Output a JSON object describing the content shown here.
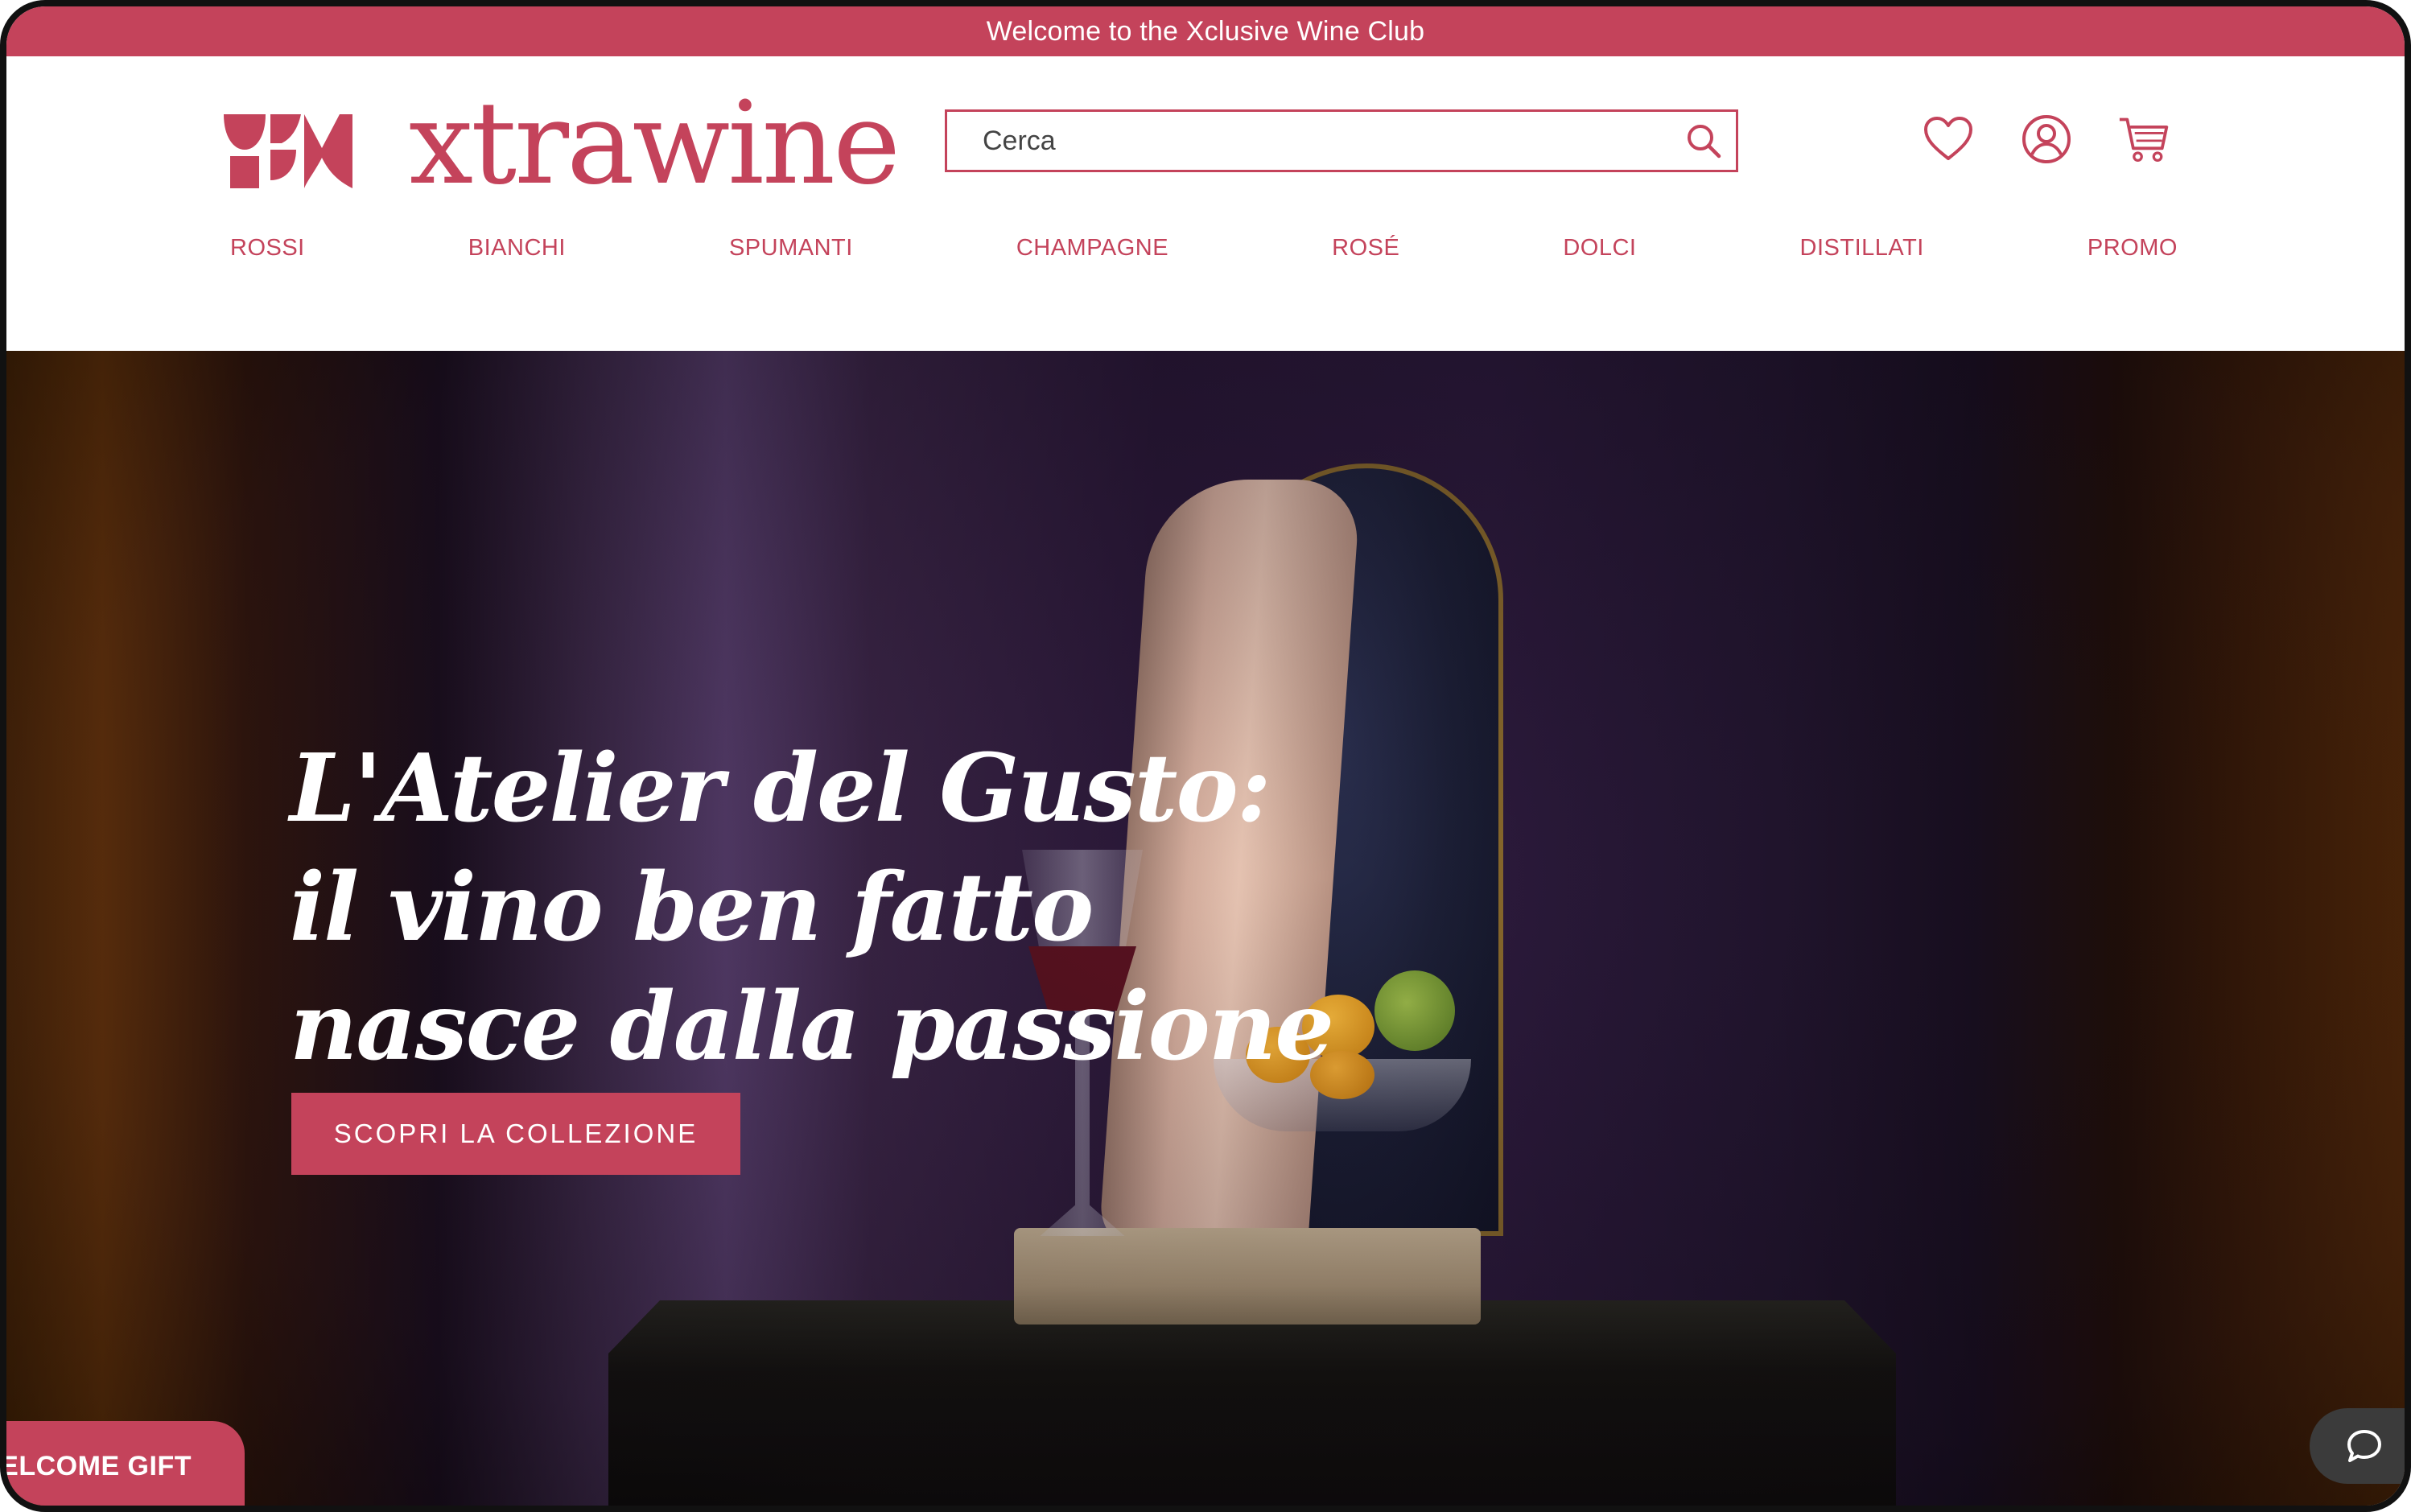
{
  "promo_bar": {
    "text": "Welcome to the Xclusive Wine Club"
  },
  "header": {
    "logo_text": "xtrawine",
    "search": {
      "placeholder": "Cerca"
    },
    "icons": [
      "heart-icon",
      "account-icon",
      "cart-icon"
    ]
  },
  "nav": {
    "items": [
      {
        "label": "ROSSI"
      },
      {
        "label": "BIANCHI"
      },
      {
        "label": "SPUMANTI"
      },
      {
        "label": "CHAMPAGNE"
      },
      {
        "label": "ROSÉ"
      },
      {
        "label": "DOLCI"
      },
      {
        "label": "DISTILLATI"
      },
      {
        "label": "PROMO"
      }
    ]
  },
  "hero": {
    "title_lines": [
      "L'Atelier del Gusto:",
      "il vino ben fatto",
      "nasce dalla passione"
    ],
    "cta_label": "SCOPRI LA COLLEZIONE"
  },
  "welcome_gift": {
    "label": "WELCOME GIFT"
  },
  "colors": {
    "brand": "#c4435b",
    "chat_bg": "#3b3b3b"
  }
}
